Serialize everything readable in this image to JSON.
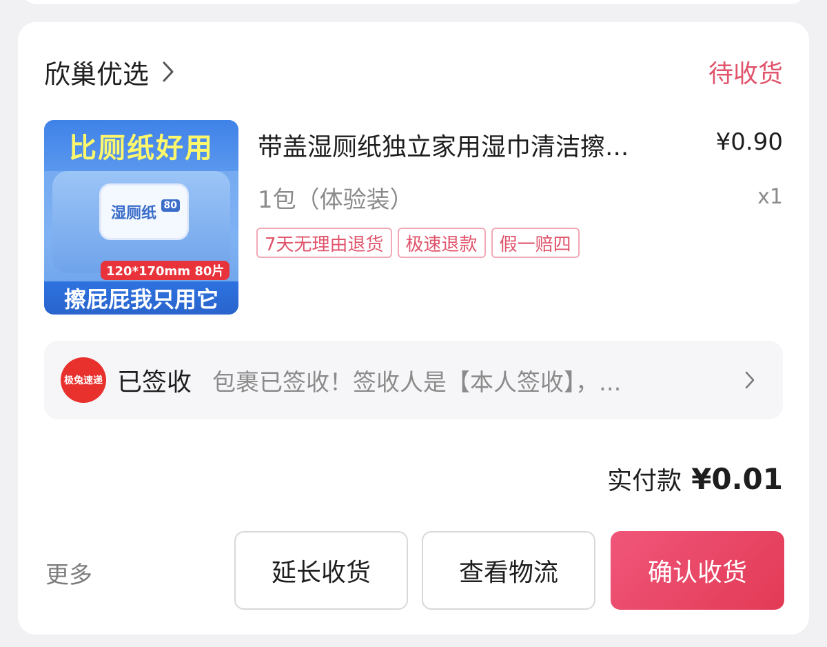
{
  "order": {
    "shop_name": "欣巢优选",
    "status": "待收货",
    "product": {
      "image": {
        "top_text": "比厕纸好用",
        "lid_label": "湿厕纸",
        "lid_count": "80",
        "size_text": "120*170mm 80片",
        "bottom_text": "擦屁屁我只用它"
      },
      "title": "带盖湿厕纸独立家用湿巾清洁擦...",
      "price": "¥0.90",
      "spec": "1包（体验装）",
      "qty": "x1",
      "tags": [
        "7天无理由退货",
        "极速退款",
        "假一赔四"
      ]
    },
    "logistics": {
      "courier_logo_text": "极兔速递",
      "status": "已签收",
      "detail": "包裹已签收！签收人是【本人签收】，..."
    },
    "payment": {
      "label": "实付款",
      "amount": "¥0.01"
    },
    "actions": {
      "more": "更多",
      "extend": "延长收货",
      "track": "查看物流",
      "confirm": "确认收货"
    }
  },
  "colors": {
    "accent": "#e0546c",
    "confirm_button": "#e23a55",
    "courier_logo": "#e8302c"
  },
  "icons": {
    "shop_chevron": "chevron-right-icon",
    "logistics_chevron": "chevron-right-icon"
  }
}
